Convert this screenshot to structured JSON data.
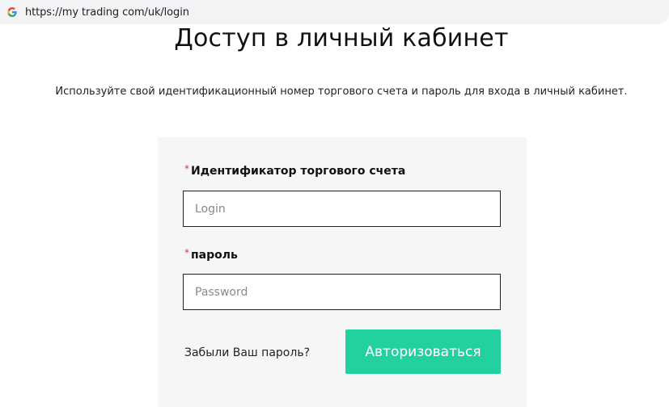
{
  "browser": {
    "url": "https://my trading com/uk/login",
    "favicon": "google-g-icon"
  },
  "page": {
    "title": "Доступ в личный кабинет",
    "subtitle": "Используйте свой идентификационный номер торгового счета и пароль для входа в личный кабинет."
  },
  "form": {
    "required_mark": "*",
    "account_label": "Идентификатор торгового счета",
    "account_placeholder": "Login",
    "account_value": "",
    "password_label": "пароль",
    "password_placeholder": "Password",
    "password_value": "",
    "forgot_label": "Забыли Ваш пароль?",
    "submit_label": "Авторизоваться"
  },
  "colors": {
    "accent": "#23d1a0",
    "required": "#e03b3b",
    "card_bg": "#f6f6f6"
  }
}
